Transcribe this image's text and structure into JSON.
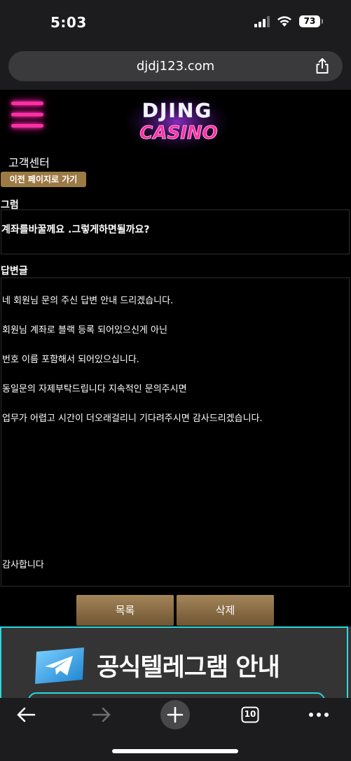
{
  "status_bar": {
    "time": "5:03",
    "battery": "73"
  },
  "browser": {
    "url": "djdj123.com"
  },
  "site": {
    "logo_top": "DJING",
    "logo_bottom": "CASINO"
  },
  "page": {
    "title": "고객센터",
    "back_button": "이전 페이지로 가기"
  },
  "question": {
    "label": "그럼",
    "text": "계좌를바꿀께요 .그렇게하면될까요?"
  },
  "answer": {
    "label": "답변글",
    "lines": [
      "네 회원님 문의 주신 답변 안내 드리겠습니다.",
      "회원님 계좌로 블랙 등록 되어있으신게 아닌",
      "번호 이름 포함해서 되어있으십니다.",
      "동일문의 자제부탁드립니다 지속적인 문의주시면",
      "업무가 어렵고 시간이 더오래걸리니 기다려주시면 감사드리겠습니다."
    ],
    "closing": "감사합니다"
  },
  "actions": {
    "list_button": "목록",
    "delete_button": "삭제"
  },
  "banner": {
    "text": "공식텔레그램 안내"
  },
  "toolbar": {
    "tabs_count": "10"
  },
  "colors": {
    "accent_gold": "#9c7a45",
    "neon_pink": "#ff2fa6",
    "banner_cyan": "#2ad8dc"
  }
}
